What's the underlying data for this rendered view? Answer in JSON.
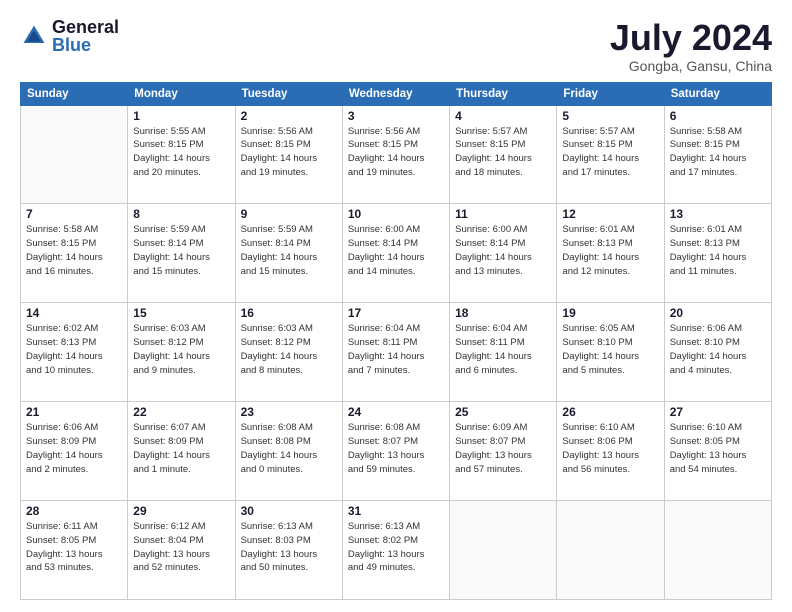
{
  "logo": {
    "general": "General",
    "blue": "Blue"
  },
  "header": {
    "month": "July 2024",
    "location": "Gongba, Gansu, China"
  },
  "days_of_week": [
    "Sunday",
    "Monday",
    "Tuesday",
    "Wednesday",
    "Thursday",
    "Friday",
    "Saturday"
  ],
  "weeks": [
    [
      {
        "day": "",
        "info": ""
      },
      {
        "day": "1",
        "info": "Sunrise: 5:55 AM\nSunset: 8:15 PM\nDaylight: 14 hours\nand 20 minutes."
      },
      {
        "day": "2",
        "info": "Sunrise: 5:56 AM\nSunset: 8:15 PM\nDaylight: 14 hours\nand 19 minutes."
      },
      {
        "day": "3",
        "info": "Sunrise: 5:56 AM\nSunset: 8:15 PM\nDaylight: 14 hours\nand 19 minutes."
      },
      {
        "day": "4",
        "info": "Sunrise: 5:57 AM\nSunset: 8:15 PM\nDaylight: 14 hours\nand 18 minutes."
      },
      {
        "day": "5",
        "info": "Sunrise: 5:57 AM\nSunset: 8:15 PM\nDaylight: 14 hours\nand 17 minutes."
      },
      {
        "day": "6",
        "info": "Sunrise: 5:58 AM\nSunset: 8:15 PM\nDaylight: 14 hours\nand 17 minutes."
      }
    ],
    [
      {
        "day": "7",
        "info": "Sunrise: 5:58 AM\nSunset: 8:15 PM\nDaylight: 14 hours\nand 16 minutes."
      },
      {
        "day": "8",
        "info": "Sunrise: 5:59 AM\nSunset: 8:14 PM\nDaylight: 14 hours\nand 15 minutes."
      },
      {
        "day": "9",
        "info": "Sunrise: 5:59 AM\nSunset: 8:14 PM\nDaylight: 14 hours\nand 15 minutes."
      },
      {
        "day": "10",
        "info": "Sunrise: 6:00 AM\nSunset: 8:14 PM\nDaylight: 14 hours\nand 14 minutes."
      },
      {
        "day": "11",
        "info": "Sunrise: 6:00 AM\nSunset: 8:14 PM\nDaylight: 14 hours\nand 13 minutes."
      },
      {
        "day": "12",
        "info": "Sunrise: 6:01 AM\nSunset: 8:13 PM\nDaylight: 14 hours\nand 12 minutes."
      },
      {
        "day": "13",
        "info": "Sunrise: 6:01 AM\nSunset: 8:13 PM\nDaylight: 14 hours\nand 11 minutes."
      }
    ],
    [
      {
        "day": "14",
        "info": "Sunrise: 6:02 AM\nSunset: 8:13 PM\nDaylight: 14 hours\nand 10 minutes."
      },
      {
        "day": "15",
        "info": "Sunrise: 6:03 AM\nSunset: 8:12 PM\nDaylight: 14 hours\nand 9 minutes."
      },
      {
        "day": "16",
        "info": "Sunrise: 6:03 AM\nSunset: 8:12 PM\nDaylight: 14 hours\nand 8 minutes."
      },
      {
        "day": "17",
        "info": "Sunrise: 6:04 AM\nSunset: 8:11 PM\nDaylight: 14 hours\nand 7 minutes."
      },
      {
        "day": "18",
        "info": "Sunrise: 6:04 AM\nSunset: 8:11 PM\nDaylight: 14 hours\nand 6 minutes."
      },
      {
        "day": "19",
        "info": "Sunrise: 6:05 AM\nSunset: 8:10 PM\nDaylight: 14 hours\nand 5 minutes."
      },
      {
        "day": "20",
        "info": "Sunrise: 6:06 AM\nSunset: 8:10 PM\nDaylight: 14 hours\nand 4 minutes."
      }
    ],
    [
      {
        "day": "21",
        "info": "Sunrise: 6:06 AM\nSunset: 8:09 PM\nDaylight: 14 hours\nand 2 minutes."
      },
      {
        "day": "22",
        "info": "Sunrise: 6:07 AM\nSunset: 8:09 PM\nDaylight: 14 hours\nand 1 minute."
      },
      {
        "day": "23",
        "info": "Sunrise: 6:08 AM\nSunset: 8:08 PM\nDaylight: 14 hours\nand 0 minutes."
      },
      {
        "day": "24",
        "info": "Sunrise: 6:08 AM\nSunset: 8:07 PM\nDaylight: 13 hours\nand 59 minutes."
      },
      {
        "day": "25",
        "info": "Sunrise: 6:09 AM\nSunset: 8:07 PM\nDaylight: 13 hours\nand 57 minutes."
      },
      {
        "day": "26",
        "info": "Sunrise: 6:10 AM\nSunset: 8:06 PM\nDaylight: 13 hours\nand 56 minutes."
      },
      {
        "day": "27",
        "info": "Sunrise: 6:10 AM\nSunset: 8:05 PM\nDaylight: 13 hours\nand 54 minutes."
      }
    ],
    [
      {
        "day": "28",
        "info": "Sunrise: 6:11 AM\nSunset: 8:05 PM\nDaylight: 13 hours\nand 53 minutes."
      },
      {
        "day": "29",
        "info": "Sunrise: 6:12 AM\nSunset: 8:04 PM\nDaylight: 13 hours\nand 52 minutes."
      },
      {
        "day": "30",
        "info": "Sunrise: 6:13 AM\nSunset: 8:03 PM\nDaylight: 13 hours\nand 50 minutes."
      },
      {
        "day": "31",
        "info": "Sunrise: 6:13 AM\nSunset: 8:02 PM\nDaylight: 13 hours\nand 49 minutes."
      },
      {
        "day": "",
        "info": ""
      },
      {
        "day": "",
        "info": ""
      },
      {
        "day": "",
        "info": ""
      }
    ]
  ]
}
